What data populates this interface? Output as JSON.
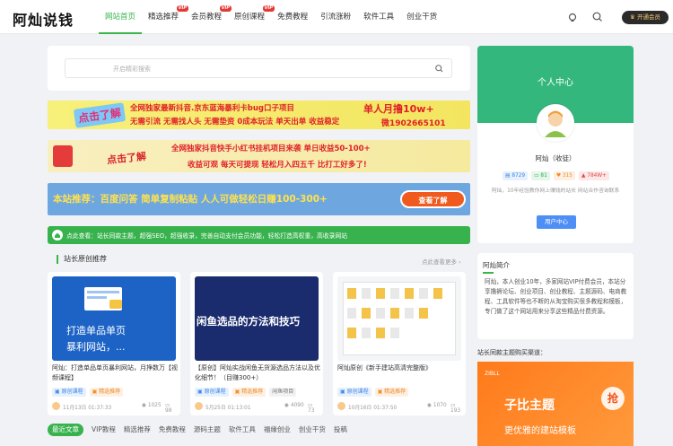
{
  "header": {
    "logo": "阿灿说钱",
    "nav": [
      {
        "label": "网站首页",
        "active": true,
        "badge": ""
      },
      {
        "label": "精选推荐",
        "active": false,
        "badge": "VIP"
      },
      {
        "label": "会员教程",
        "active": false,
        "badge": "VIP"
      },
      {
        "label": "原创课程",
        "active": false,
        "badge": "VIP"
      },
      {
        "label": "免费教程",
        "active": false,
        "badge": ""
      },
      {
        "label": "引流涨粉",
        "active": false,
        "badge": ""
      },
      {
        "label": "软件工具",
        "active": false,
        "badge": ""
      },
      {
        "label": "创业干货",
        "active": false,
        "badge": ""
      }
    ],
    "vip_button": "开通会员",
    "icons": [
      "theme-toggle-icon",
      "search-icon"
    ]
  },
  "search": {
    "placeholder": "开启精彩搜索"
  },
  "banners": {
    "b1": {
      "click": "点击了解",
      "line1": "全网独家最新抖音.京东蓝海暴利卡bug口子项目",
      "line2": "无需引流 无需找人头 无需垫资 0成本玩法 单天出单 收益稳定",
      "right1": "单人月撸10w+",
      "right2": "微1902665101"
    },
    "b2": {
      "click": "点击了解",
      "line1": "全网独家抖音快手小红书挂机项目来袭 单日收益50-100+",
      "line2": "收益可观  每天可提现  轻松月入四五千  比打工好多了!"
    },
    "b3": {
      "text": "本站推荐：百度问答 简单复制粘贴 人人可做轻松日赚100-300+",
      "cta": "查看了解"
    }
  },
  "notice": {
    "text": "点此查看：站长同款主题，超强SEO，超强收录，完善自动支付会员功能，轻松打造高权重，高收录网站"
  },
  "section": {
    "title": "站长原创推荐",
    "more": "点此查看更多"
  },
  "cards": [
    {
      "thumb_line1": "打造单品单页",
      "thumb_line2": "暴利网站，...",
      "title": "阿灿：打造单品单页暴利网站，月挣数万【视频课程】",
      "tags": [
        "原创课程",
        "精选推荐"
      ],
      "date": "11月13日 01:37:33",
      "views": "1025",
      "comments": "98"
    },
    {
      "thumb_line1": "闲鱼选品的方法和技巧",
      "title": "【原创】阿灿实战闲鱼无货源选品方法以及优化细节！（目赚300+）",
      "tags": [
        "原创课程",
        "精选推荐",
        "闲鱼项目"
      ],
      "date": "5月25日 01:13:01",
      "views": "4090",
      "comments": "73"
    },
    {
      "title": "阿灿原创《新手建站高清完整版》",
      "tags": [
        "原创课程",
        "精选推荐"
      ],
      "date": "10月16日 01:37:50",
      "views": "1070",
      "comments": "193"
    }
  ],
  "tabs": [
    {
      "label": "最近文章",
      "active": true
    },
    {
      "label": "VIP教程",
      "active": false
    },
    {
      "label": "精选推荐",
      "active": false
    },
    {
      "label": "免费教程",
      "active": false
    },
    {
      "label": "源码主题",
      "active": false
    },
    {
      "label": "软件工具",
      "active": false
    },
    {
      "label": "福缘创业",
      "active": false
    },
    {
      "label": "创业干货",
      "active": false
    },
    {
      "label": "投稿",
      "active": false
    }
  ],
  "profile": {
    "header": "个人中心",
    "name": "阿灿（收徒）",
    "stats": [
      "8729",
      "81",
      "315",
      "784W+"
    ],
    "bio": "阿灿，10年经验教你网上赚钱的站长 网站合作咨询联系",
    "button": "用户中心"
  },
  "intro": {
    "title": "阿灿简介",
    "text": "阿灿，本人创业10年，多家网站VIP付费会员，本站分享撸褥论坛、创业项目、创业教程、主题源码、电商教程、工具软件等也不断的从淘宝购买很多教程和模板，专门做了这个网站用来分享这些精品付费资源。"
  },
  "theme": {
    "title": "站长同款主题购买渠道：",
    "brand": "ZIBLL",
    "big": "子比主题",
    "sub": "更优雅的建站模板",
    "badge": "抢"
  },
  "colors": {
    "accent": "#39b54a",
    "profile": "#34b77c",
    "banner3": "#6ea7e0",
    "theme": "#ff7a1a"
  }
}
